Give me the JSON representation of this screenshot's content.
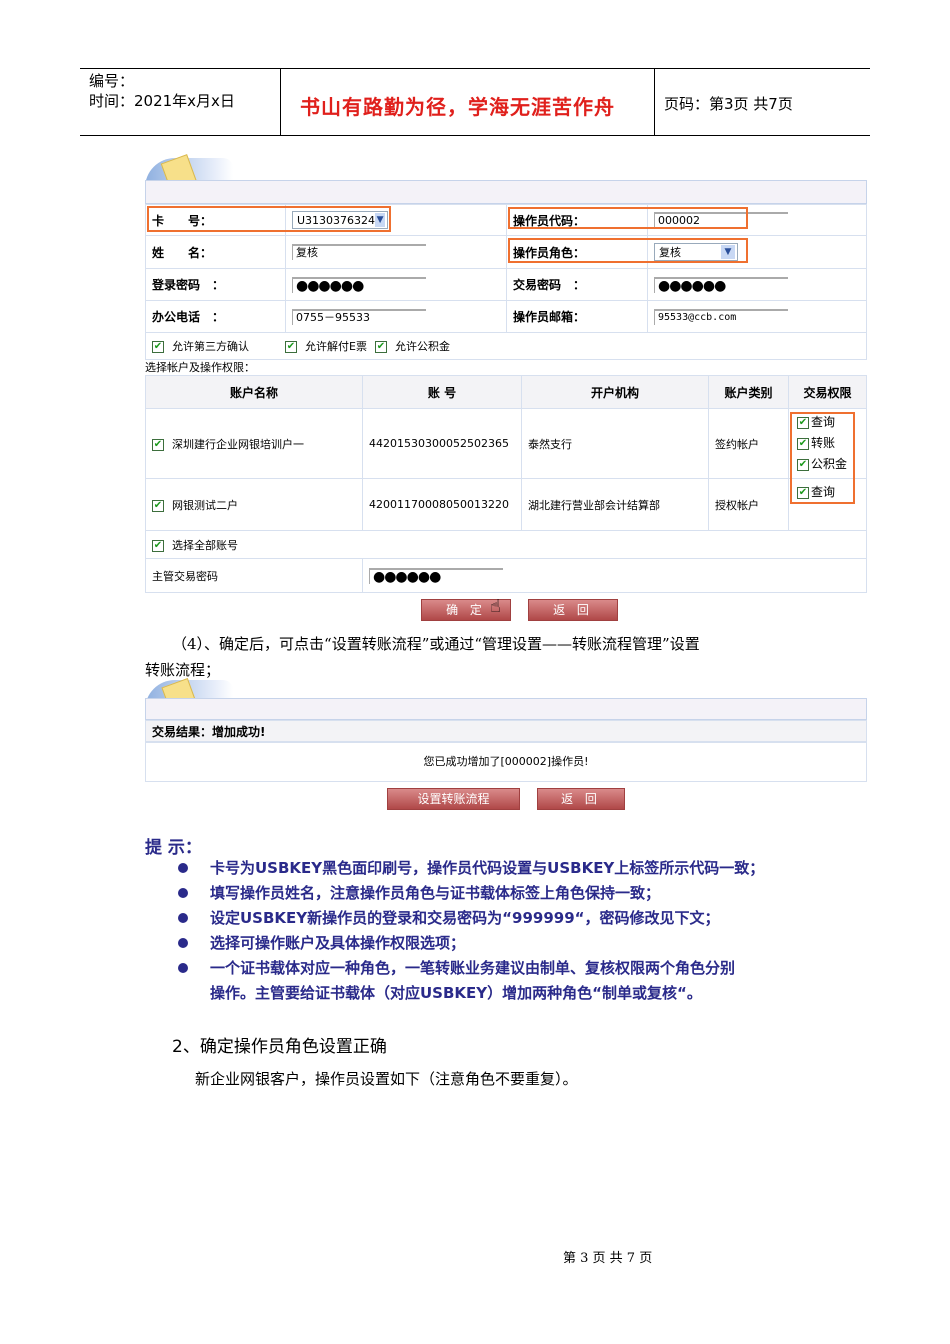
{
  "header": {
    "number_label": "编号：",
    "time_label": "时间：2021年x月x日",
    "motto": "书山有路勤为径，学海无涯苦作舟",
    "page_info": "页码：第3页  共7页"
  },
  "form": {
    "card_label": "卡　　号：",
    "card_value": "U3130376324",
    "code_label": "操作员代码：",
    "code_value": "000002",
    "name_label": "姓　　名：",
    "name_value": "复核",
    "role_label": "操作员角色：",
    "role_value": "复核",
    "login_pwd_label": "登录密码　：",
    "login_pwd_value": "●●●●●●",
    "trade_pwd_label": "交易密码　：",
    "trade_pwd_value": "●●●●●●",
    "phone_label": "办公电话　：",
    "phone_value": "0755－95533",
    "email_label": "操作员邮箱：",
    "email_value": "95533@ccb.com",
    "options": [
      "允许第三方确认",
      "允许解付E票",
      "允许公积金"
    ],
    "accounts_title": "选择帐户及操作权限：",
    "columns": [
      "账户名称",
      "账 号",
      "开户机构",
      "账户类别",
      "交易权限"
    ],
    "accounts": [
      {
        "name": "深圳建行企业网银培训户一",
        "number": "44201530300052502365",
        "org": "泰然支行",
        "type": "签约帐户",
        "perms": [
          "查询",
          "转账",
          "公积金"
        ]
      },
      {
        "name": "网银测试二户",
        "number": "42001170008050013220",
        "org": "湖北建行营业部会计结算部",
        "type": "授权帐户",
        "perms": [
          "查询"
        ]
      }
    ],
    "select_all": "选择全部账号",
    "supervisor_pwd_label": "主管交易密码",
    "supervisor_pwd_value": "●●●●●●",
    "confirm": "确 定",
    "back": "返 回"
  },
  "para1": "（4）、确定后，可点击“设置转账流程”或通过“管理设置——转账流程管理”设置",
  "para2": "转账流程；",
  "result": {
    "title": "交易结果：增加成功!",
    "message": "您已成功增加了[000002]操作员!",
    "flow_button": "设置转账流程",
    "back": "返 回"
  },
  "tips": {
    "title": "提  示：",
    "items": [
      "卡号为USBKEY黑色面印刷号，操作员代码设置与USBKEY上标签所示代码一致；",
      "填写操作员姓名，注意操作员角色与证书载体标签上角色保持一致；",
      "设定USBKEY新操作员的登录和交易密码为“999999“，密码修改见下文；",
      "选择可操作账户及具体操作权限选项；",
      "一个证书载体对应一种角色，一笔转账业务建议由制单、复核权限两个角色分别",
      "操作。主管要给证书载体（对应USBKEY）增加两种角色“制单或复核“。"
    ]
  },
  "section": {
    "heading": "2、确定操作员角色设置正确",
    "text": "新企业网银客户，操作员设置如下（注意角色不要重复）。"
  },
  "footer": "第 3 页 共 7 页"
}
